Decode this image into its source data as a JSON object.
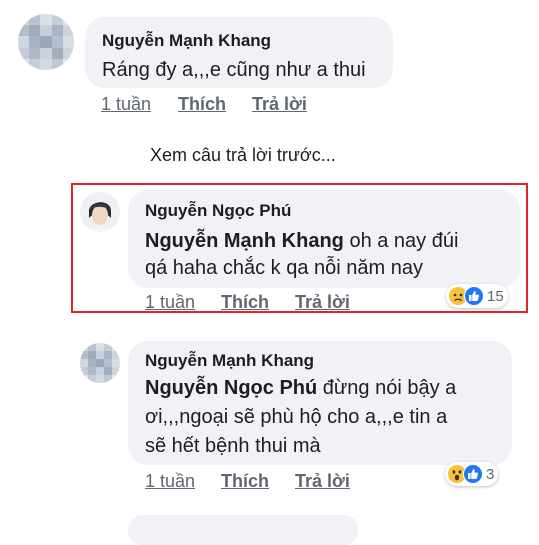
{
  "comments": [
    {
      "name": "Nguyễn Mạnh Khang",
      "text": "Ráng đy a,,,e cũng như a thui",
      "time": "1 tuần",
      "like": "Thích",
      "reply": "Trả lời"
    },
    {
      "view_previous": "Xem câu trả lời trước..."
    },
    {
      "name": "Nguyễn Ngọc Phú",
      "mention": "Nguyễn Mạnh Khang",
      "text_line1": " oh a nay đúi",
      "text_line2": "qá haha chắc k qa nỗi năm nay",
      "time": "1 tuần",
      "like": "Thích",
      "reply": "Trả lời",
      "reaction_count": "15",
      "highlight_color": "#e0242b"
    },
    {
      "name": "Nguyễn Mạnh Khang",
      "mention": "Nguyễn Ngọc Phú",
      "text_line1": " đừng nói bậy a",
      "text_line2": "ơi,,,ngoại sẽ phù hộ cho a,,,e tin a",
      "text_line3": "sẽ hết bệnh thui mà",
      "time": "1 tuần",
      "like": "Thích",
      "reply": "Trả lời",
      "reaction_count": "3"
    }
  ],
  "icons": {
    "like": "like-reaction-icon",
    "sad": "sad-reaction-icon",
    "wow": "wow-reaction-icon"
  },
  "colors": {
    "bubble": "#f0f2f5",
    "like_blue": "#2078f4",
    "emoji_yellow": "#f7c13a"
  }
}
